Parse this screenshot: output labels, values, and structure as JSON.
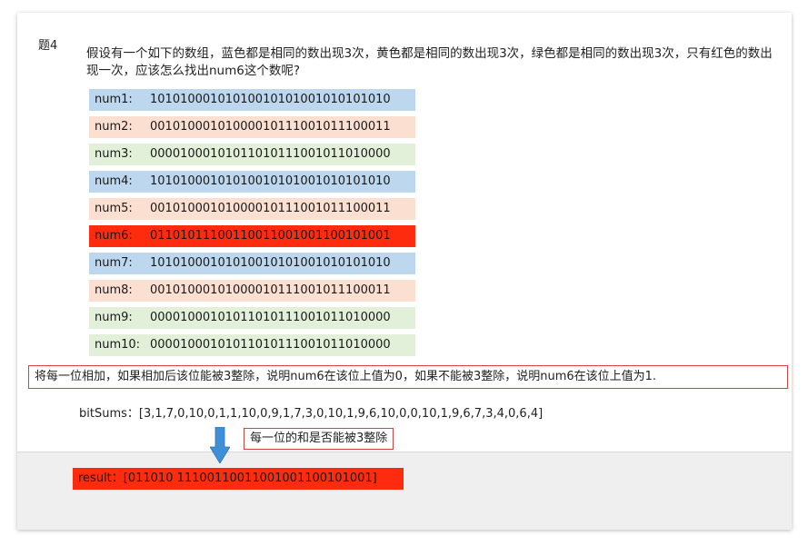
{
  "title": "题4",
  "question": "假设有一个如下的数组，蓝色都是相同的数出现3次，黄色都是相同的数出现3次，绿色都是相同的数出现3次，只有红色的数出现一次，应该怎么找出num6这个数呢?",
  "rows": [
    {
      "label": "num1:",
      "bits": "10101000101010010101001010101010",
      "color": "#bdd7ee"
    },
    {
      "label": "num2:",
      "bits": "00101000101000010111001011100011",
      "color": "#fbe0d2"
    },
    {
      "label": "num3:",
      "bits": "00001000101011010111001011010000",
      "color": "#e2efd9"
    },
    {
      "label": "num4:",
      "bits": "10101000101010010101001010101010",
      "color": "#bdd7ee"
    },
    {
      "label": "num5:",
      "bits": "00101000101000010111001011100011",
      "color": "#fbe0d2"
    },
    {
      "label": "num6:",
      "bits": "01101011100110011001001100101001",
      "color": "#fe2b0f"
    },
    {
      "label": "num7:",
      "bits": "10101000101010010101001010101010",
      "color": "#bdd7ee"
    },
    {
      "label": "num8:",
      "bits": "00101000101000010111001011100011",
      "color": "#fbe0d2"
    },
    {
      "label": "num9:",
      "bits": "00001000101011010111001011010000",
      "color": "#e2efd9"
    },
    {
      "label": "num10:",
      "bits": "00001000101011010111001011010000",
      "color": "#e2efd9"
    }
  ],
  "explanation": "将每一位相加，如果相加后该位能被3整除，说明num6在该位上值为0，如果不能被3整除，说明num6在该位上值为1.",
  "bitsums_label": "bitSums：",
  "bitsums_value": "[3,1,7,0,10,0,1,1,10,0,9,1,7,3,0,10,1,9,6,10,0,0,10,1,9,6,7,3,4,0,6,4]",
  "note": "每一位的和是否能被3整除",
  "result_label": "result：",
  "result_value": "[011010 11100110011001001100101001]",
  "colors": {
    "accent_red": "#d9433a",
    "arrow_blue": "#3f8fd8",
    "result_bg": "#fe2b0f"
  }
}
